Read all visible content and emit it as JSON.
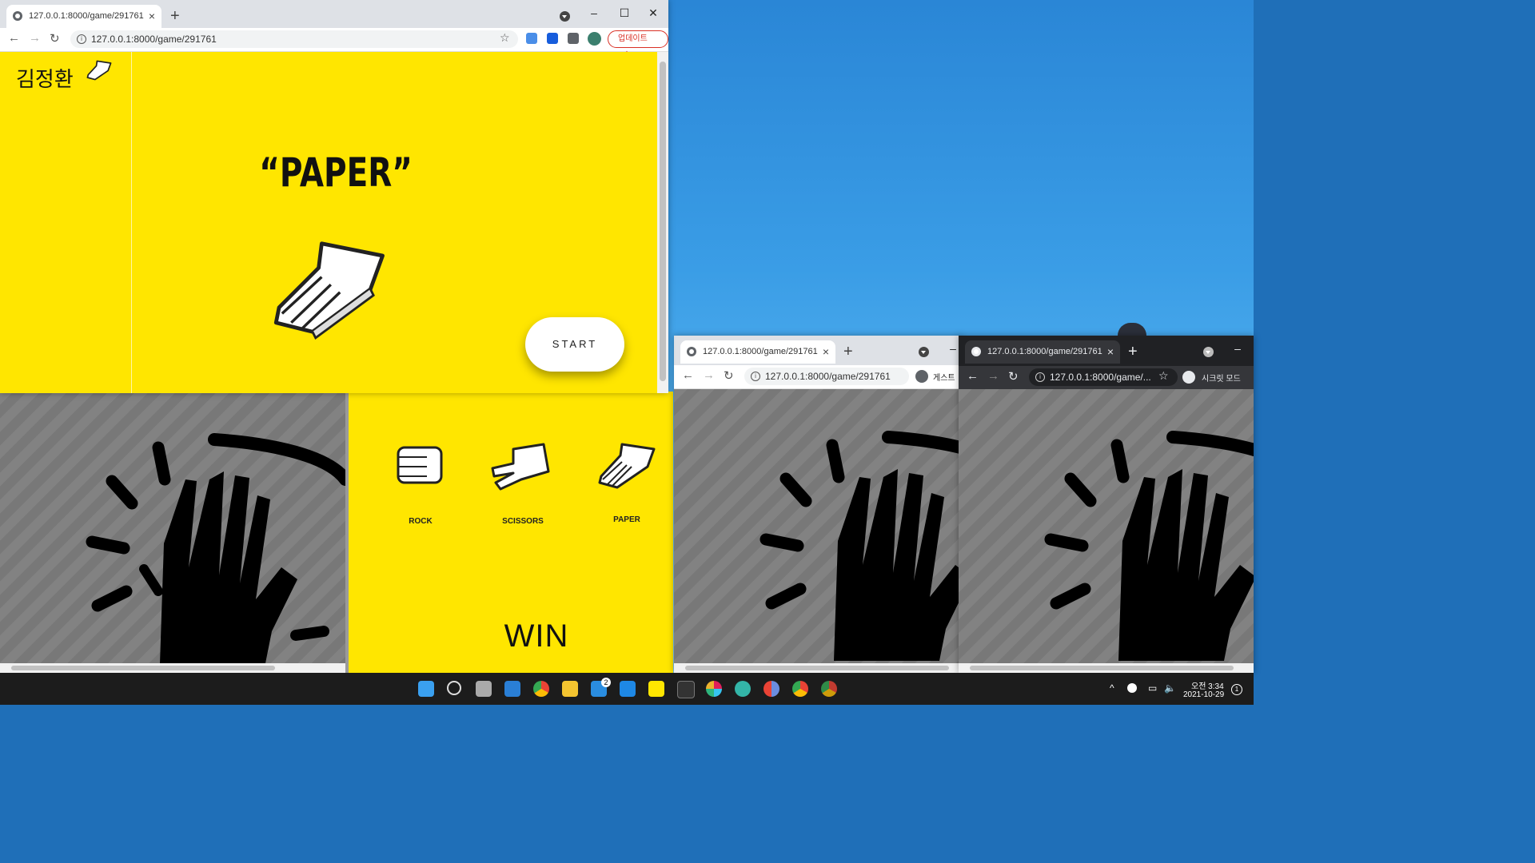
{
  "main_window": {
    "tab_title": "127.0.0.1:8000/game/291761",
    "url": "127.0.0.1:8000/game/291761",
    "update_button": "업데이트",
    "player_name": "김정환",
    "choice_text": "“PAPER”",
    "start_button": "START"
  },
  "bottom_left_window": {},
  "choices_panel": {
    "options": [
      {
        "label": "ROCK",
        "icon": "rock-hand-icon"
      },
      {
        "label": "SCISSORS",
        "icon": "scissors-hand-icon"
      },
      {
        "label": "PAPER",
        "icon": "paper-hand-icon"
      }
    ],
    "result": "WIN"
  },
  "guest_window": {
    "tab_title": "127.0.0.1:8000/game/291761",
    "url": "127.0.0.1:8000/game/291761",
    "profile_label": "게스트"
  },
  "incognito_window": {
    "tab_title": "127.0.0.1:8000/game/291761",
    "url": "127.0.0.1:8000/game/...",
    "profile_label": "시크릿 모드"
  },
  "taskbar": {
    "clock_period": "오전 3:34",
    "clock_date": "2021-10-29",
    "mail_badge": "2",
    "notification_count": "1"
  },
  "colors": {
    "game_yellow": "#ffe600",
    "hatch_gray": "#7d7d7d",
    "update_red": "#d93025"
  }
}
